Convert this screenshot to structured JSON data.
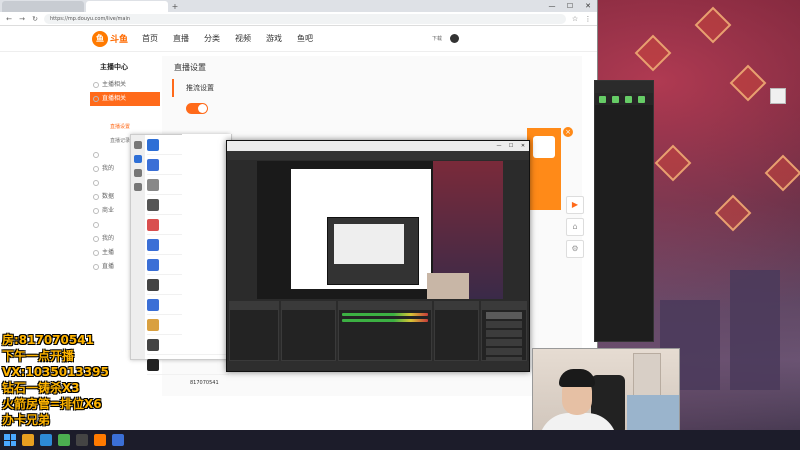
{
  "browser": {
    "tabs": [
      {
        "label": ""
      },
      {
        "label": ""
      }
    ],
    "url": "https://mp.douyu.com/live/main",
    "window_controls": [
      "—",
      "☐",
      "✕"
    ]
  },
  "site": {
    "logo_text": "斗鱼",
    "nav": [
      {
        "label": "首页",
        "hot": false
      },
      {
        "label": "直播",
        "hot": false
      },
      {
        "label": "分类",
        "hot": false
      },
      {
        "label": "视频",
        "hot": true
      },
      {
        "label": "游戏",
        "hot": true
      },
      {
        "label": "鱼吧",
        "hot": false
      }
    ],
    "download_label": "下载",
    "username": ""
  },
  "side_menu": {
    "title": "主播中心",
    "items": [
      {
        "label": "主播相关",
        "active": false,
        "sub": false,
        "current": false
      },
      {
        "label": "直播相关",
        "active": true,
        "sub": false,
        "current": false
      },
      {
        "label": "",
        "active": false,
        "sub": true,
        "current": false
      },
      {
        "label": "直播设置",
        "active": false,
        "sub": true,
        "current": true
      },
      {
        "label": "直播记录",
        "active": false,
        "sub": true,
        "current": false
      },
      {
        "label": "",
        "active": false,
        "sub": false,
        "current": false
      },
      {
        "label": "我的",
        "active": false,
        "sub": false,
        "current": false
      },
      {
        "label": "",
        "active": false,
        "sub": false,
        "current": false
      },
      {
        "label": "数据",
        "active": false,
        "sub": false,
        "current": false
      },
      {
        "label": "商业",
        "active": false,
        "sub": false,
        "current": false
      },
      {
        "label": "",
        "active": false,
        "sub": false,
        "current": false
      },
      {
        "label": "我的",
        "active": false,
        "sub": false,
        "current": false
      },
      {
        "label": "主播",
        "active": false,
        "sub": false,
        "current": false
      },
      {
        "label": "直播",
        "active": false,
        "sub": false,
        "current": false
      }
    ]
  },
  "main": {
    "section_title": "直播设置",
    "subsection_title": "推流设置",
    "push_switch_label": "",
    "link1": "",
    "link2": "",
    "room_label": "",
    "room_id": "817070541",
    "room_status": ""
  },
  "promo": {
    "top": "",
    "bottom": "",
    "close": "×"
  },
  "chat": {
    "contacts": [
      {
        "name": "",
        "color": "#2e6fd6"
      },
      {
        "name": "",
        "color": "#3b6fd6"
      },
      {
        "name": "",
        "color": "#888888"
      },
      {
        "name": "",
        "color": "#555555"
      },
      {
        "name": "",
        "color": "#d94f4f"
      },
      {
        "name": "",
        "color": "#3b6fd6"
      },
      {
        "name": "",
        "color": "#3b6fd6"
      },
      {
        "name": "",
        "color": "#444444"
      },
      {
        "name": "",
        "color": "#3b6fd6"
      },
      {
        "name": "",
        "color": "#d9a040"
      },
      {
        "name": "",
        "color": "#444444"
      },
      {
        "name": "",
        "color": "#222222"
      }
    ]
  },
  "chat_pane": {
    "title": "",
    "lines": [
      {
        "text": "",
        "dark": false
      },
      {
        "text": "",
        "dark": true
      },
      {
        "text": "",
        "dark": false
      },
      {
        "text": "",
        "dark": true
      },
      {
        "text": "",
        "dark": false
      },
      {
        "text": "",
        "dark": true
      },
      {
        "text": "",
        "dark": false
      },
      {
        "text": "",
        "dark": true
      },
      {
        "text": "",
        "dark": false
      },
      {
        "text": "",
        "dark": true
      }
    ]
  },
  "obs": {
    "title": "",
    "menu": [
      "",
      "",
      "",
      "",
      "",
      "",
      "",
      ""
    ],
    "docks": {
      "scenes": {
        "title": "",
        "items": [
          "",
          ""
        ]
      },
      "sources": {
        "title": "",
        "items": [
          "",
          "",
          "",
          "",
          ""
        ]
      },
      "mixer": {
        "title": "",
        "channels": [
          "",
          ""
        ]
      },
      "transitions": {
        "title": "",
        "type": "",
        "duration_label": "",
        "duration": ""
      },
      "controls": {
        "title": "",
        "buttons": [
          "",
          "",
          "",
          "",
          "",
          ""
        ]
      }
    },
    "status": [
      "",
      "",
      "",
      "",
      ""
    ]
  },
  "side_panel": {
    "title": "",
    "lines": [
      "",
      "",
      "",
      "",
      "",
      "",
      "",
      "",
      "",
      "",
      "",
      "",
      ""
    ]
  },
  "overlay": {
    "lines": [
      "房:817070541",
      "下午一点开播",
      "VX:1035013395",
      "钻石一铸杀X3",
      "火箭房管=排位X6",
      "办卡兄弟"
    ]
  },
  "desktop_icon": {
    "label": ""
  },
  "taskbar": {
    "time": "",
    "date": ""
  }
}
